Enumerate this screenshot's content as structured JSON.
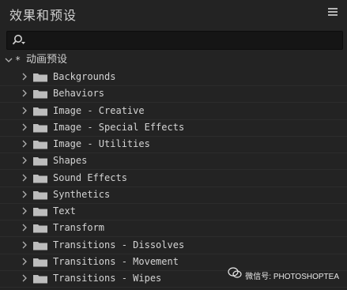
{
  "panel": {
    "title": "效果和预设"
  },
  "search": {
    "value": "",
    "placeholder": ""
  },
  "tree": {
    "root_marker": "*",
    "root_label": "动画预设",
    "items": [
      {
        "label": "Backgrounds"
      },
      {
        "label": "Behaviors"
      },
      {
        "label": "Image - Creative"
      },
      {
        "label": "Image - Special Effects"
      },
      {
        "label": "Image - Utilities"
      },
      {
        "label": "Shapes"
      },
      {
        "label": "Sound Effects"
      },
      {
        "label": "Synthetics"
      },
      {
        "label": "Text"
      },
      {
        "label": "Transform"
      },
      {
        "label": "Transitions - Dissolves"
      },
      {
        "label": "Transitions - Movement"
      },
      {
        "label": "Transitions - Wipes"
      }
    ]
  },
  "watermark": {
    "text": "微信号: PHOTOSHOPTEA"
  },
  "colors": {
    "background": "#232323",
    "search_bg": "#151515",
    "folder": "#bdbdbd",
    "text": "#d4d4d4"
  },
  "icons": {
    "menu": "hamburger-icon",
    "search": "search-icon",
    "expand": "chevron-down-icon",
    "collapse": "chevron-right-icon",
    "folder": "folder-icon",
    "watermark": "wechat-icon"
  }
}
